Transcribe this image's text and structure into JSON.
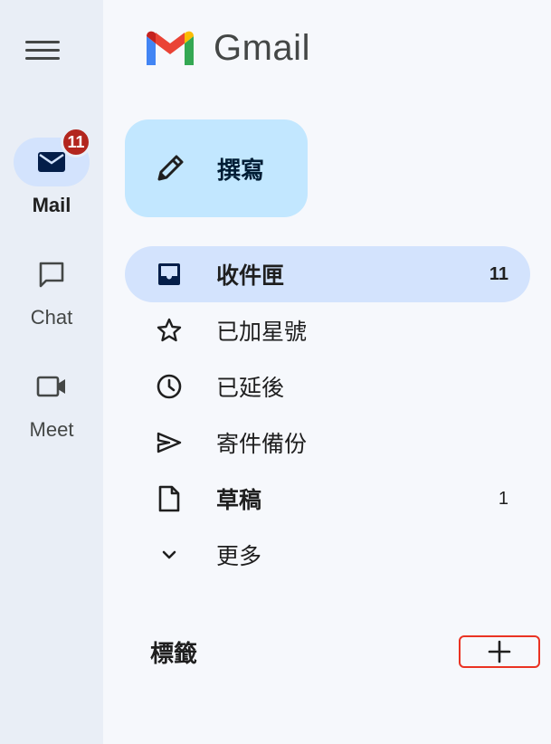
{
  "app": {
    "name": "Gmail"
  },
  "rail": {
    "items": [
      {
        "label": "Mail",
        "badge": "11",
        "icon": "mail-icon"
      },
      {
        "label": "Chat",
        "icon": "chat-icon"
      },
      {
        "label": "Meet",
        "icon": "video-icon"
      }
    ]
  },
  "compose": {
    "label": "撰寫",
    "icon": "pencil-icon"
  },
  "nav": {
    "items": [
      {
        "label": "收件匣",
        "count": "11",
        "icon": "inbox-icon"
      },
      {
        "label": "已加星號",
        "icon": "star-icon"
      },
      {
        "label": "已延後",
        "icon": "clock-icon"
      },
      {
        "label": "寄件備份",
        "icon": "send-icon"
      },
      {
        "label": "草稿",
        "count": "1",
        "icon": "draft-icon"
      },
      {
        "label": "更多",
        "icon": "chevron-down-icon"
      }
    ]
  },
  "labels": {
    "header": "標籤",
    "add_icon": "plus-icon"
  },
  "colors": {
    "rail_bg": "#e9eef6",
    "main_bg": "#f6f8fc",
    "active_bg": "#d3e3fd",
    "compose_bg": "#c2e7ff",
    "badge_bg": "#b3261e",
    "highlight_border": "#ea3323"
  }
}
